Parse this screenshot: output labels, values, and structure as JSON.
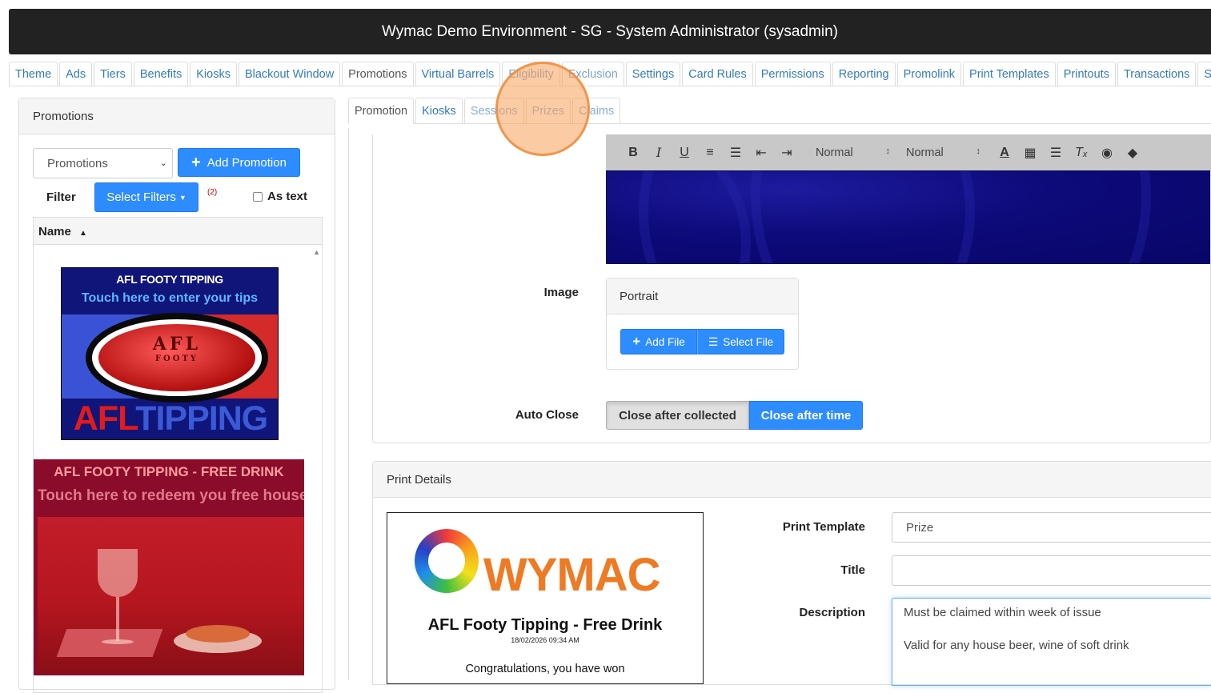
{
  "window": {
    "title": "Wymac Demo Environment - SG - System Administrator (sysadmin)"
  },
  "main_tabs": [
    {
      "label": "Theme"
    },
    {
      "label": "Ads"
    },
    {
      "label": "Tiers"
    },
    {
      "label": "Benefits"
    },
    {
      "label": "Kiosks"
    },
    {
      "label": "Blackout Window"
    },
    {
      "label": "Promotions"
    },
    {
      "label": "Virtual Barrels"
    },
    {
      "label": "Eligibility"
    },
    {
      "label": "Exclusion"
    },
    {
      "label": "Settings"
    },
    {
      "label": "Card Rules"
    },
    {
      "label": "Permissions"
    },
    {
      "label": "Reporting"
    },
    {
      "label": "Promolink"
    },
    {
      "label": "Print Templates"
    },
    {
      "label": "Printouts"
    },
    {
      "label": "Transactions"
    },
    {
      "label": "SignalR"
    }
  ],
  "left_panel": {
    "title": "Promotions",
    "select_value": "Promotions",
    "add_label": "Add Promotion",
    "filter_label": "Filter",
    "select_filters_label": "Select Filters",
    "filter_count": "(2)",
    "as_text_label": "As text",
    "column_name": "Name",
    "items": [
      {
        "line1": "AFL FOOTY TIPPING",
        "line2": "Touch here to enter your tips",
        "ball_text": "AFL",
        "ball_sub": "FOOTY",
        "big_red": "AFL",
        "big_blue": "TIPPING"
      },
      {
        "line1": "AFL FOOTY TIPPING - FREE DRINK",
        "line2": "Touch here to redeem you free house d"
      }
    ]
  },
  "sub_tabs": [
    {
      "label": "Promotion"
    },
    {
      "label": "Kiosks"
    },
    {
      "label": "Sessions"
    },
    {
      "label": "Prizes"
    },
    {
      "label": "Claims"
    }
  ],
  "editor": {
    "toolbar": {
      "bold": "B",
      "italic": "I",
      "underline": "U",
      "size_select": "Normal",
      "font_select": "Normal"
    }
  },
  "form": {
    "image_label": "Image",
    "image_box_title": "Portrait",
    "add_file_label": "Add File",
    "select_file_label": "Select File",
    "auto_close_label": "Auto Close",
    "auto_close_options": [
      "Close after collected",
      "Close after time"
    ],
    "auto_close_selected": "Close after time"
  },
  "print_details": {
    "title": "Print Details",
    "ticket": {
      "logo_text": "WYMAC",
      "title": "AFL Footy Tipping - Free Drink",
      "datetime": "18/02/2026 09:34 AM",
      "message": "Congratulations, you have won"
    },
    "print_template_label": "Print Template",
    "print_template_value": "Prize",
    "title_label": "Title",
    "title_value": "",
    "description_label": "Description",
    "description_lines": [
      "Must be claimed within week of issue",
      "Valid for any house beer, wine of soft drink"
    ]
  },
  "colors": {
    "primary": "#2d8cff",
    "link": "#337ab7",
    "titlebar": "#222222",
    "cursor_highlight": "#f7a05a"
  }
}
